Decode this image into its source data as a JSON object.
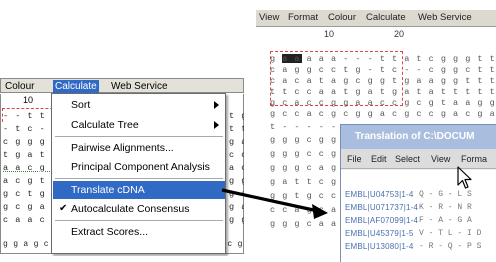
{
  "left": {
    "menubar": {
      "colour": "Colour",
      "calculate": "Calculate",
      "web_service": "Web Service"
    },
    "ruler": "10",
    "seq_rows": [
      "- - t t a",
      "- t c - -",
      "c g g g t",
      "t g a t a",
      "a a c g g",
      "a c g t g",
      "g c t g c",
      "g c g a c",
      "c a a c t"
    ],
    "seq_right_rows": [
      "t g",
      "t t",
      "g a",
      "c c",
      "a c",
      "g g",
      "g a",
      "g a",
      "g g"
    ],
    "bottom_row": "g g a g c c a c t g t c g c c g a t c t c g c g c a c",
    "menu": {
      "items": [
        {
          "label": "Sort",
          "submenu": true
        },
        {
          "label": "Calculate Tree",
          "submenu": true
        },
        {
          "label": "Pairwise Alignments..."
        },
        {
          "label": "Principal Component Analysis"
        },
        {
          "label": "Translate cDNA",
          "highlighted": true
        },
        {
          "label": "Autocalculate Consensus",
          "checked": true
        },
        {
          "label": "Extract Scores..."
        }
      ]
    }
  },
  "right": {
    "menubar": {
      "view": "View",
      "format": "Format",
      "colour": "Colour",
      "calculate": "Calculate",
      "web_service": "Web Service"
    },
    "ruler": [
      "10",
      "20"
    ],
    "seq_rows": [
      "g a a a a a - - - t t a t c g g g t t t t a",
      "c a g g c c t g - t c - - c g g c t t t t a",
      "c a c a t a g c g g t g a a g g t t t c t t",
      "t t c c a a t g a t g a t a t t t t t c c c",
      "g c a c c g g a a c c g c g t a a g g g a a",
      "g c c a c g c g g a c g c c g a c g a c g g",
      "t - - - - - - - - - - - - g a a g g g a a",
      "g g g c g g - -",
      "g g g c c g c -",
      "g g g c a g g t",
      "g a t t c g c c",
      "g g t g c c g -",
      "c c a g c a a g",
      "g g g c a a t t"
    ],
    "dialog": {
      "title": "Translation of C:\\DOCUM",
      "menu": [
        "File",
        "Edit",
        "Select",
        "View",
        "Forma"
      ],
      "rows": [
        {
          "id": "EMBL|U04753|1-4",
          "aa": "Q - G - L S"
        },
        {
          "id": "EMBL|U071737|1-4",
          "aa": "K - R - N R"
        },
        {
          "id": "EMBL|AF07099|1-4",
          "aa": "F - A - G A"
        },
        {
          "id": "EMBL|U45379|1-5",
          "aa": "V - T L - I D"
        },
        {
          "id": "EMBL|U13080|1-4",
          "aa": "- R - Q - P S"
        }
      ]
    }
  }
}
